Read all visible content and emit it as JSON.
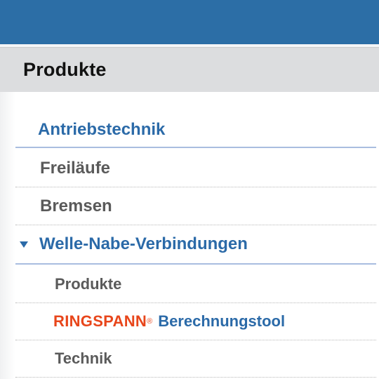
{
  "header": {
    "title": "Produkte"
  },
  "nav": {
    "category": "Antriebstechnik",
    "items": [
      {
        "label": "Freiläufe"
      },
      {
        "label": "Bremsen"
      },
      {
        "label": "Welle-Nabe-Verbindungen",
        "expanded": true
      }
    ],
    "subitems": [
      {
        "label": "Produkte"
      },
      {
        "brand": "RINGSPANN",
        "brand_mark": "®",
        "label": "Berechnungstool"
      },
      {
        "label": "Technik"
      }
    ]
  },
  "colors": {
    "top_bar": "#2c6ea6",
    "header_bg": "#dcdddf",
    "link_blue": "#2b6aa8",
    "text_gray": "#5a5a5a",
    "brand_orange": "#e8461b"
  },
  "icons": {
    "expand": "triangle-down-icon"
  }
}
